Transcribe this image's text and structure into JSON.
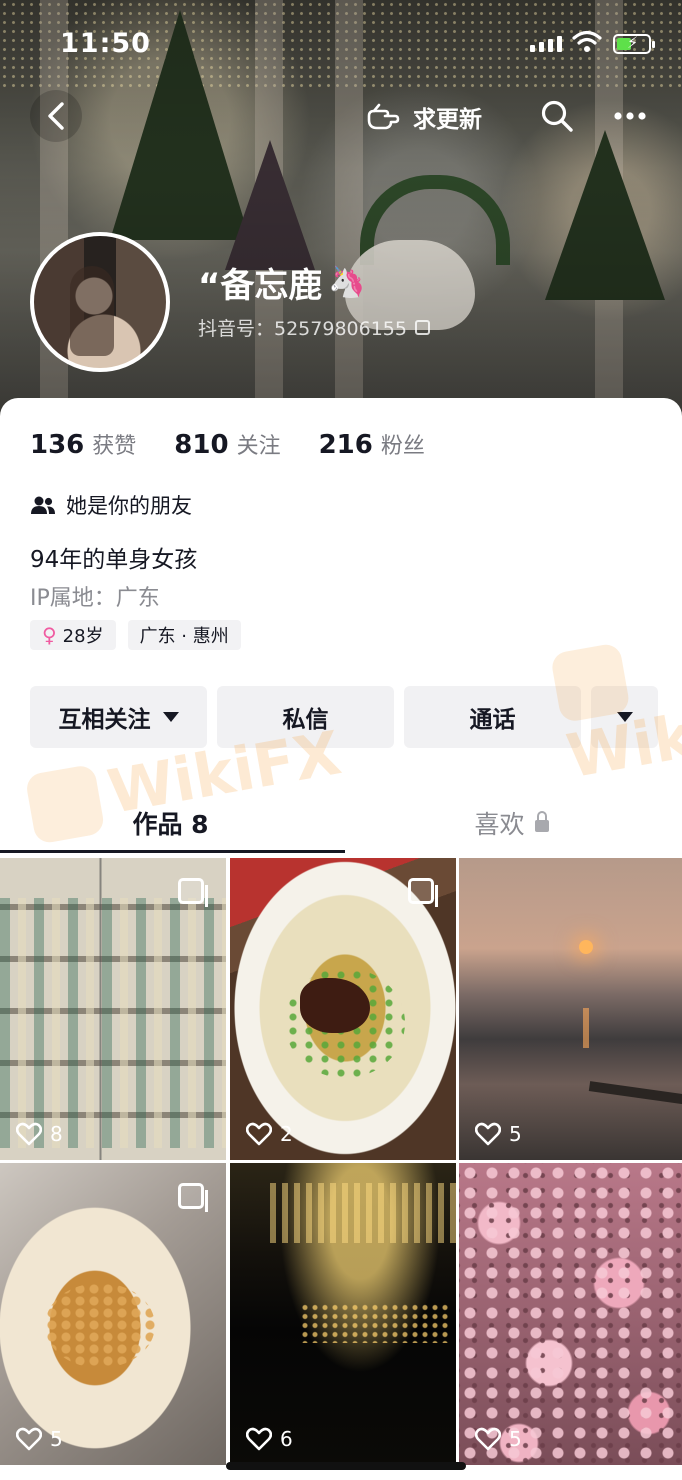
{
  "status_bar": {
    "time": "11:50"
  },
  "top_bar": {
    "request_update_label": "求更新"
  },
  "profile": {
    "nickname": "“备忘鹿",
    "nickname_emoji": "🦄",
    "douyin_id": "抖音号：52579806155",
    "stats": [
      {
        "num": "136",
        "label": "获赞"
      },
      {
        "num": "810",
        "label": "关注"
      },
      {
        "num": "216",
        "label": "粉丝"
      }
    ],
    "relation": "她是你的朋友",
    "bio": "94年的单身女孩",
    "ip_location": "IP属地：广东",
    "tags": {
      "age": "28岁",
      "region": "广东 · 惠州"
    }
  },
  "actions": {
    "follow_label": "互相关注",
    "message_label": "私信",
    "call_label": "通话"
  },
  "tabs": {
    "works_label": "作品 8",
    "likes_label": "喜欢"
  },
  "watermark": "WikiFX",
  "grid": [
    {
      "likes": "8",
      "multi_image": true
    },
    {
      "likes": "2",
      "multi_image": true
    },
    {
      "likes": "5",
      "multi_image": false
    },
    {
      "likes": "5",
      "multi_image": true
    },
    {
      "likes": "6",
      "multi_image": false
    },
    {
      "likes": "5",
      "multi_image": false
    }
  ]
}
